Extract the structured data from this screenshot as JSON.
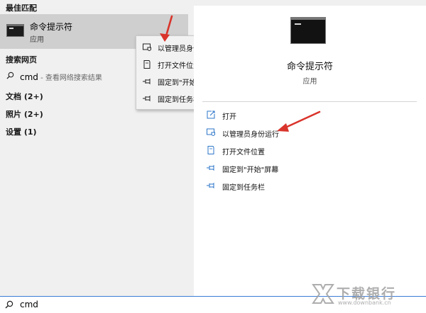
{
  "left": {
    "best_match_heading": "最佳匹配",
    "best_match": {
      "title": "命令提示符",
      "subtitle": "应用"
    },
    "web_heading": "搜索网页",
    "web_result": {
      "query": "cmd",
      "suffix": " - 查看网络搜索结果"
    },
    "categories": [
      "文档 (2+)",
      "照片 (2+)",
      "设置 (1)"
    ]
  },
  "context_menu": {
    "items": [
      "以管理员身份运行",
      "打开文件位置",
      "固定到\"开始\"屏幕",
      "固定到任务栏"
    ]
  },
  "right": {
    "title": "命令提示符",
    "subtitle": "应用",
    "actions": [
      "打开",
      "以管理员身份运行",
      "打开文件位置",
      "固定到\"开始\"屏幕",
      "固定到任务栏"
    ]
  },
  "search": {
    "value": "cmd"
  },
  "watermark": {
    "text": "下载银行",
    "url": "www.downbank.cn"
  },
  "colors": {
    "accent": "#3a7bd5",
    "arrow": "#d9342b",
    "selection": "#cfcfcf"
  }
}
